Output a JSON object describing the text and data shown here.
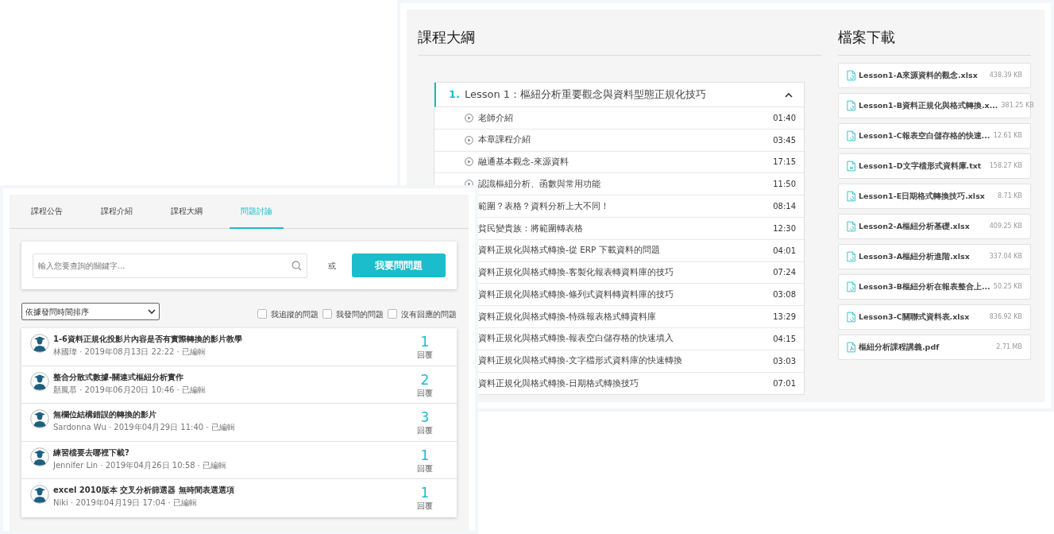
{
  "syllabus": {
    "title": "課程大綱",
    "chapter": {
      "number": "1.",
      "title": "Lesson 1：樞紐分析重要觀念與資料型態正規化技巧",
      "expanded": true
    },
    "lessons": [
      {
        "title": "老師介紹",
        "duration": "01:40",
        "play_icon": true
      },
      {
        "title": "本章課程介紹",
        "duration": "03:45",
        "play_icon": true
      },
      {
        "title": "融通基本觀念-來源資料",
        "duration": "17:15",
        "play_icon": true
      },
      {
        "title": "認識樞紐分析、函數與常用功能",
        "duration": "11:50",
        "play_icon": true
      },
      {
        "title": "範圍？表格？資料分析上大不同！",
        "duration": "08:14",
        "play_icon": false
      },
      {
        "title": "貧民變貴族：將範圍轉表格",
        "duration": "12:30",
        "play_icon": false
      },
      {
        "title": "資料正規化與格式轉換-從 ERP 下載資料的問題",
        "duration": "04:01",
        "play_icon": false
      },
      {
        "title": "資料正規化與格式轉換-客製化報表轉資料庫的技巧",
        "duration": "07:24",
        "play_icon": false
      },
      {
        "title": "資料正規化與格式轉換-條列式資料轉資料庫的技巧",
        "duration": "03:08",
        "play_icon": false
      },
      {
        "title": "資料正規化與格式轉換-特殊報表格式轉資料庫",
        "duration": "13:29",
        "play_icon": false
      },
      {
        "title": "資料正規化與格式轉換-報表空白儲存格的快速填入",
        "duration": "04:15",
        "play_icon": false
      },
      {
        "title": "資料正規化與格式轉換-文字檔形式資料庫的快速轉換",
        "duration": "03:03",
        "play_icon": false
      },
      {
        "title": "資料正規化與格式轉換-日期格式轉換技巧",
        "duration": "07:01",
        "play_icon": false
      }
    ]
  },
  "downloads": {
    "title": "檔案下載",
    "files": [
      {
        "name": "Lesson1-A來源資料的觀念.xlsx",
        "size": "438.39 KB",
        "kind": "sheet"
      },
      {
        "name": "Lesson1-B資料正規化與格式轉換.x...",
        "size": "381.25 KB",
        "kind": "sheet"
      },
      {
        "name": "Lesson1-C報表空白儲存格的快速...",
        "size": "12.61 KB",
        "kind": "sheet"
      },
      {
        "name": "Lesson1-D文字檔形式資料庫.txt",
        "size": "158.27 KB",
        "kind": "text"
      },
      {
        "name": "Lesson1-E日期格式轉換技巧.xlsx",
        "size": "8.71 KB",
        "kind": "sheet"
      },
      {
        "name": "Lesson2-A樞紐分析基礎.xlsx",
        "size": "409.25 KB",
        "kind": "sheet"
      },
      {
        "name": "Lesson3-A樞紐分析進階.xlsx",
        "size": "337.04 KB",
        "kind": "sheet"
      },
      {
        "name": "Lesson3-B樞紐分析在報表整合上...",
        "size": "50.25 KB",
        "kind": "sheet"
      },
      {
        "name": "Lesson3-C關聯式資料表.xlsx",
        "size": "836.92 KB",
        "kind": "sheet"
      },
      {
        "name": "樞紐分析課程講義.pdf",
        "size": "2.71 MB",
        "kind": "pdf"
      }
    ]
  },
  "discussion": {
    "tabs": [
      {
        "label": "課程公告",
        "selected": false
      },
      {
        "label": "課程介紹",
        "selected": false
      },
      {
        "label": "課程大綱",
        "selected": false
      },
      {
        "label": "問題討論",
        "selected": true
      }
    ],
    "search": {
      "placeholder": "輸入您要查詢的關鍵字..."
    },
    "or": "或",
    "ask_button": "我要問問題",
    "sort": {
      "value": "依據發問時間排序"
    },
    "filters": [
      {
        "label": "我追蹤的問題",
        "checked": false
      },
      {
        "label": "我發問的問題",
        "checked": false
      },
      {
        "label": "沒有回應的問題",
        "checked": false
      }
    ],
    "questions": [
      {
        "title": "1-6資料正規化投影片內容是否有實際轉換的影片教學",
        "meta": "林國瑋 · 2019年08月13日 22:22 · 已編輯",
        "replies": "1",
        "replies_label": "回覆"
      },
      {
        "title": "整合分散式數據-關連式樞紐分析實作",
        "meta": "顏鳳慕 · 2019年06月20日 10:46 · 已編輯",
        "replies": "2",
        "replies_label": "回覆"
      },
      {
        "title": "無欄位結構錯誤的轉換的影片",
        "meta": "Sardonna Wu · 2019年04月29日 11:40 · 已編輯",
        "replies": "3",
        "replies_label": "回覆"
      },
      {
        "title": "練習檔要去哪裡下載?",
        "meta": "Jennifer Lin · 2019年04月26日 10:58 · 已編輯",
        "replies": "1",
        "replies_label": "回覆"
      },
      {
        "title": "excel 2010版本 交叉分析篩選器 無時間表選選項",
        "meta": "Niki · 2019年04月19日 17:04 · 已編輯",
        "replies": "1",
        "replies_label": "回覆"
      }
    ]
  }
}
